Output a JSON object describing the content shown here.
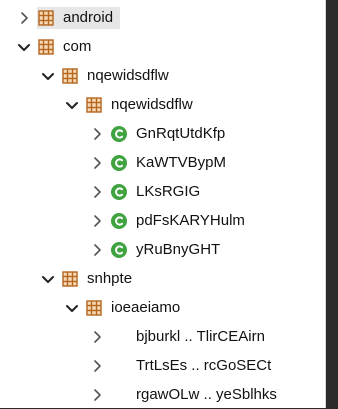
{
  "tree": {
    "items": [
      {
        "label": "android",
        "kind": "package",
        "expanded": false,
        "depth": 0,
        "selected": true
      },
      {
        "label": "com",
        "kind": "package",
        "expanded": true,
        "depth": 0
      },
      {
        "label": "nqewidsdflw",
        "kind": "package",
        "expanded": true,
        "depth": 1
      },
      {
        "label": "nqewidsdflw",
        "kind": "package",
        "expanded": true,
        "depth": 2
      },
      {
        "label": "GnRqtUtdKfp",
        "kind": "class",
        "expanded": false,
        "depth": 3
      },
      {
        "label": "KaWTVBypM",
        "kind": "class",
        "expanded": false,
        "depth": 3
      },
      {
        "label": "LKsRGIG",
        "kind": "class",
        "expanded": false,
        "depth": 3
      },
      {
        "label": "pdFsKARYHulm",
        "kind": "class",
        "expanded": false,
        "depth": 3
      },
      {
        "label": "yRuBnyGHT",
        "kind": "class",
        "expanded": false,
        "depth": 3
      },
      {
        "label": "snhpte",
        "kind": "package",
        "expanded": true,
        "depth": 1
      },
      {
        "label": "ioeaeiamo",
        "kind": "package",
        "expanded": true,
        "depth": 2
      },
      {
        "label": "bjburkl .. TlirCEAirn",
        "kind": "none",
        "expanded": false,
        "depth": 3
      },
      {
        "label": "TrtLsEs .. rcGoSECt",
        "kind": "none",
        "expanded": false,
        "depth": 3
      },
      {
        "label": "rgawOLw .. yeSblhks",
        "kind": "none",
        "expanded": false,
        "depth": 3
      }
    ]
  },
  "colors": {
    "package_icon": "#b5651d",
    "class_icon": "#3fa33f",
    "chevron": "#555555",
    "selected_bg": "#e6e6e6",
    "frame": "#2b2b2b"
  },
  "icons": {
    "package": "package-icon",
    "class": "class-icon",
    "collapsed": "chevron-right-icon",
    "expanded": "chevron-down-icon"
  }
}
